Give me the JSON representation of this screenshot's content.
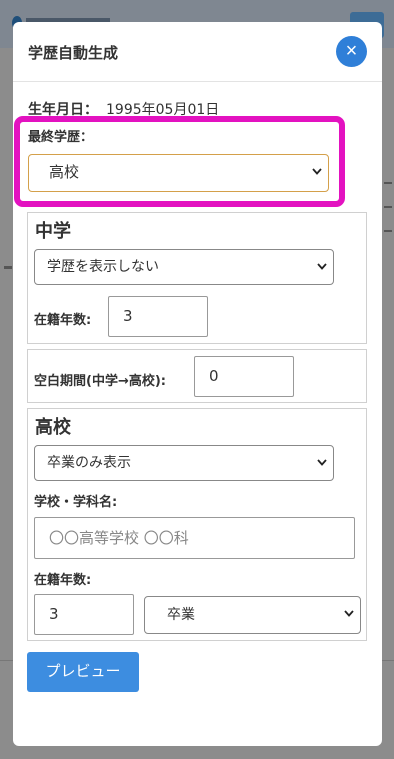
{
  "modal": {
    "title": "学歴自動生成",
    "close_label": "×"
  },
  "birthdate": {
    "label": "生年月日：",
    "value": "1995年05月01日"
  },
  "final_education": {
    "label": "最終学歴：",
    "selected": "高校"
  },
  "middle_school": {
    "heading": "中学",
    "display_select": "学歴を表示しない",
    "years_label": "在籍年数:",
    "years_value": "3"
  },
  "gap": {
    "label": "空白期間(中学→高校):",
    "value": "0"
  },
  "high_school": {
    "heading": "高校",
    "display_select": "卒業のみ表示",
    "school_label": "学校・学科名:",
    "school_placeholder": "〇〇高等学校 〇〇科",
    "years_label": "在籍年数:",
    "years_value": "3",
    "status_select": "卒業"
  },
  "preview_button": "プレビュー",
  "colors": {
    "accent": "#2f7fd8",
    "highlight": "#e312c0"
  }
}
